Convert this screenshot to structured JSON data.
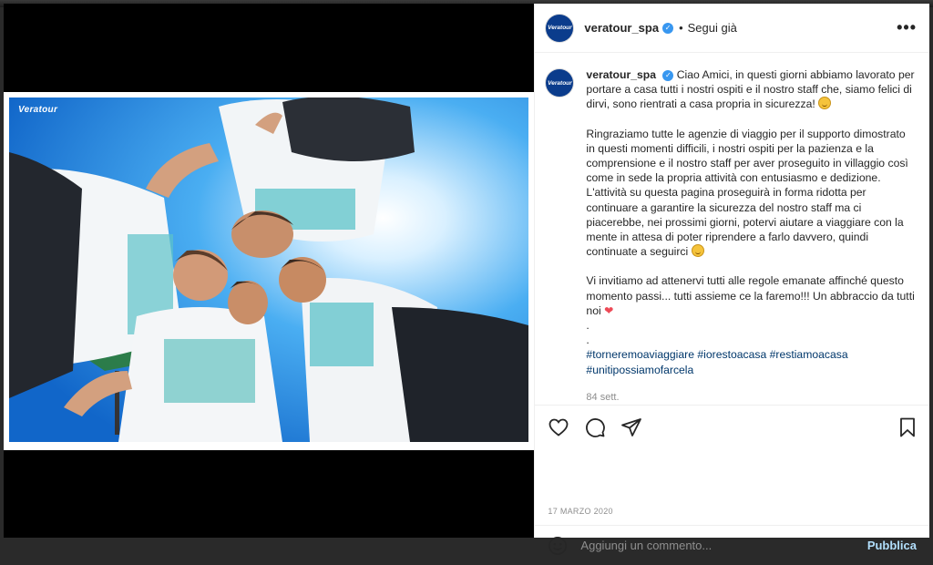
{
  "post": {
    "username": "veratour_spa",
    "follow_label": "Segui già",
    "more_label": "•••",
    "brand_mark": "Veratour",
    "caption_intro": "Ciao Amici, in questi giorni abbiamo lavorato per portare a casa tutti i nostri ospiti e il nostro staff che, siamo felici di dirvi, sono rientrati a casa propria in sicurezza!",
    "caption_p2a": "Ringraziamo tutte le agenzie di viaggio per il supporto dimostrato in questi momenti difficili, i nostri ospiti per la pazienza e la comprensione e il nostro staff per aver proseguito in villaggio così come in sede la propria attività con entusiasmo e dedizione.",
    "caption_p2b": "L'attività su questa pagina proseguirà in forma ridotta per continuare a garantire la sicurezza del nostro staff ma ci piacerebbe, nei prossimi giorni, potervi aiutare a viaggiare con la mente in attesa di poter riprendere a farlo davvero, quindi continuate a seguirci",
    "caption_p3": "Vi invitiamo ad attenervi tutti alle regole emanate affinché questo momento passi... tutti assieme ce la faremo!!! Un abbraccio da tutti noi",
    "dot1": ".",
    "dot2": ".",
    "hashtags": "#torneremoaviaggiare #iorestoacasa #restiamoacasa #unitipossiamofarcela",
    "time_ago": "84 sett.",
    "date": "17 MARZO 2020"
  },
  "comment": {
    "placeholder": "Aggiungi un commento...",
    "publish_label": "Pubblica"
  },
  "icons": {
    "like": "heart-icon",
    "comment": "comment-icon",
    "share": "paper-plane-icon",
    "save": "bookmark-icon",
    "emoji": "smiley-icon",
    "verified": "verified-badge-icon"
  },
  "colors": {
    "link": "#00376b",
    "verified": "#3897f0",
    "publish_disabled": "#b2dffc",
    "brand": "#0b3c8c"
  }
}
